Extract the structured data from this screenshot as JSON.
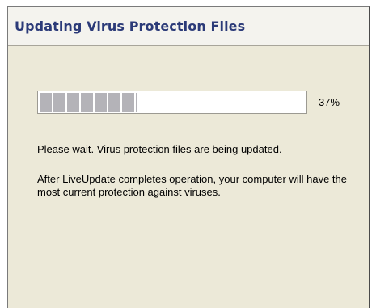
{
  "window": {
    "title": "Updating Virus Protection Files"
  },
  "progress": {
    "value": 0.37,
    "label": "37%"
  },
  "messages": {
    "status": "Please wait. Virus protection files are being updated.",
    "info": "After LiveUpdate completes operation, your computer will have the most current protection against viruses."
  },
  "colors": {
    "title_text": "#2b3a78",
    "progress_segment": "#b4b3b8",
    "panel_background": "#ece9d8"
  }
}
